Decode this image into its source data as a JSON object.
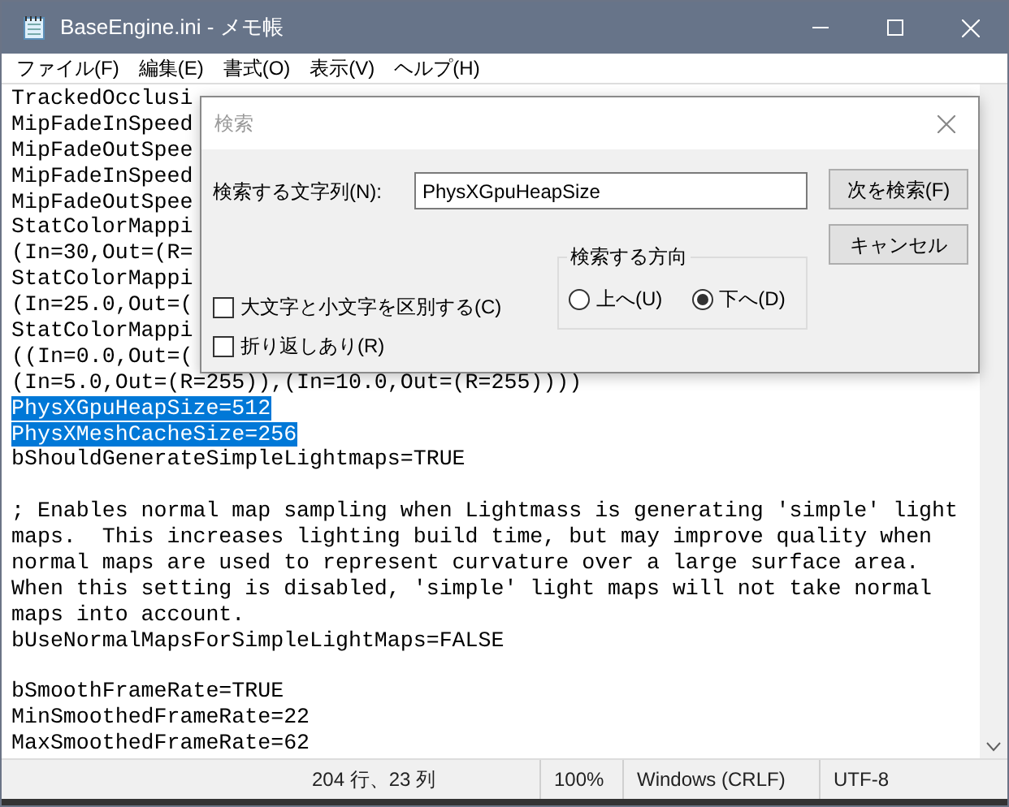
{
  "window": {
    "title": "BaseEngine.ini - メモ帳"
  },
  "menu": [
    "ファイル(F)",
    "編集(E)",
    "書式(O)",
    "表示(V)",
    "ヘルプ(H)"
  ],
  "editor": {
    "blocks": [
      {
        "lines": [
          {
            "text": "TrackedOcclusi",
            "selected": false
          },
          {
            "text": "MipFadeInSpeed",
            "selected": false
          },
          {
            "text": "MipFadeOutSpee",
            "selected": false
          },
          {
            "text": "MipFadeInSpeed",
            "selected": false
          },
          {
            "text": "MipFadeOutSpee",
            "selected": false
          },
          {
            "text": "StatColorMappi",
            "selected": false
          },
          {
            "text": "(In=30,Out=(R=",
            "selected": false
          },
          {
            "text": "StatColorMappi",
            "selected": false
          },
          {
            "text": "(In=25.0,Out=(",
            "selected": false
          },
          {
            "text": "StatColorMappi",
            "selected": false
          },
          {
            "text": "((In=0.0,Out=(",
            "selected": false
          },
          {
            "text": "(In=5.0,Out=(R=255)),(In=10.0,Out=(R=255))))",
            "selected": false
          },
          {
            "text": "PhysXGpuHeapSize=512",
            "selected": true
          },
          {
            "text": "PhysXMeshCacheSize=256",
            "selected": true
          },
          {
            "text": "bShouldGenerateSimpleLightmaps=TRUE",
            "selected": false
          }
        ]
      },
      {
        "lines": [
          {
            "text": "; Enables normal map sampling when Lightmass is generating 'simple' light",
            "selected": false
          },
          {
            "text": "maps.  This increases lighting build time, but may improve quality when",
            "selected": false
          },
          {
            "text": "normal maps are used to represent curvature over a large surface area.",
            "selected": false
          },
          {
            "text": "When this setting is disabled, 'simple' light maps will not take normal",
            "selected": false
          },
          {
            "text": "maps into account.",
            "selected": false
          },
          {
            "text": "bUseNormalMapsForSimpleLightMaps=FALSE",
            "selected": false
          }
        ]
      },
      {
        "lines": [
          {
            "text": "bSmoothFrameRate=TRUE",
            "selected": false
          },
          {
            "text": "MinSmoothedFrameRate=22",
            "selected": false
          },
          {
            "text": "MaxSmoothedFrameRate=62",
            "selected": false
          }
        ]
      }
    ]
  },
  "find_dialog": {
    "title": "検索",
    "search_label": "検索する文字列(N):",
    "search_value": "PhysXGpuHeapSize",
    "find_next": "次を検索(F)",
    "cancel": "キャンセル",
    "options": [
      {
        "label": "大文字と小文字を区別する(C)",
        "checked": false
      },
      {
        "label": "折り返しあり(R)",
        "checked": false
      }
    ],
    "direction": {
      "label": "検索する方向",
      "choices": [
        {
          "label": "上へ(U)",
          "selected": false
        },
        {
          "label": "下へ(D)",
          "selected": true
        }
      ]
    }
  },
  "status_bar": [
    "204 行、23 列",
    "100%",
    "Windows (CRLF)",
    "UTF-8"
  ]
}
